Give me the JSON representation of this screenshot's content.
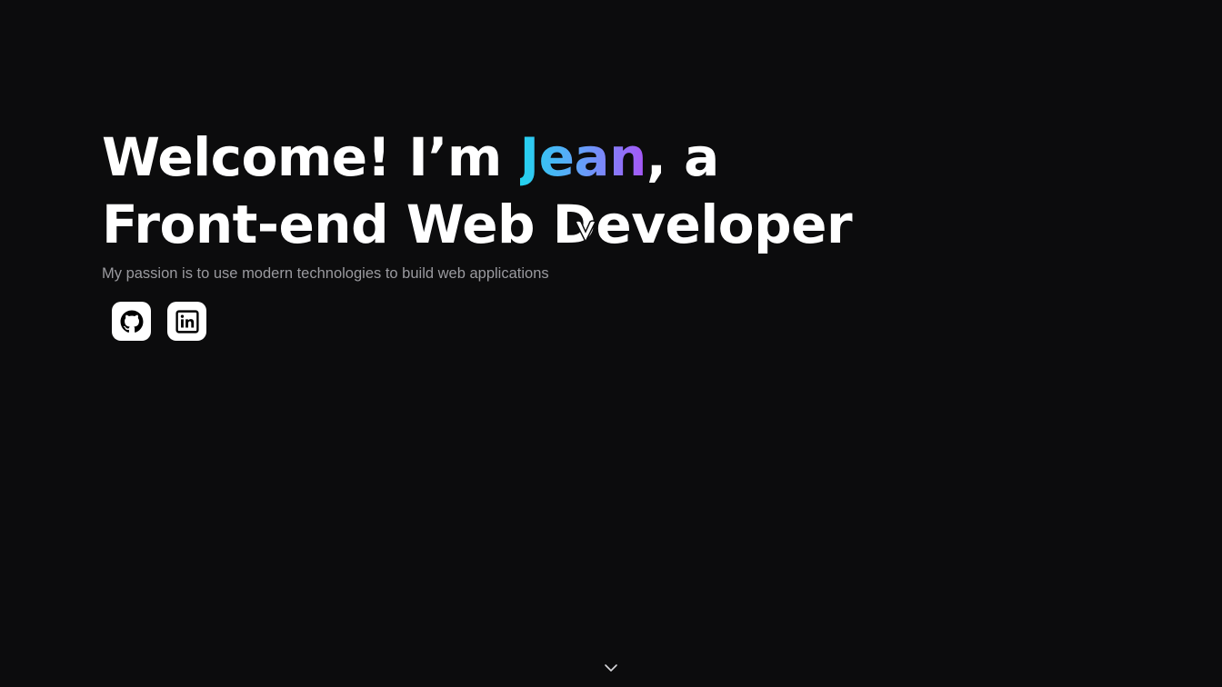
{
  "hero": {
    "headline_prefix": "Welcome! I’m ",
    "name": "Jean",
    "headline_suffix": ", a",
    "headline_line2": "Front-end Web Developer",
    "subtitle": "My passion is to use modern technologies to build web applications"
  },
  "socials": {
    "github_icon": "github-icon",
    "linkedin_icon": "linkedin-icon"
  },
  "icons": {
    "scroll_down": "chevron-down-icon",
    "cursor": "cursor-icon"
  },
  "colors": {
    "background": "#0c0c0d",
    "text": "#ffffff",
    "subtitle": "#9a9a9f",
    "name_gradient_start": "#22d3ee",
    "name_gradient_mid": "#60a5fa",
    "name_gradient_end": "#a855f7"
  }
}
